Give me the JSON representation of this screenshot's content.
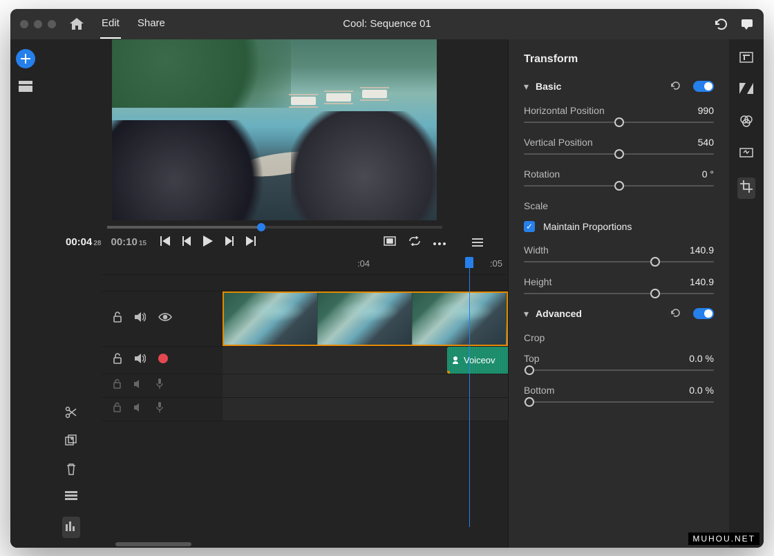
{
  "window": {
    "title": "Cool: Sequence 01"
  },
  "tabs": {
    "edit": "Edit",
    "share": "Share"
  },
  "timecode": {
    "current": "00:04",
    "current_frames": "28",
    "duration": "00:10",
    "duration_frames": "15"
  },
  "ruler": {
    "tick_a": ":04",
    "tick_b": ":05"
  },
  "audio_clip": {
    "label": "Voiceov"
  },
  "inspector": {
    "title": "Transform",
    "basic": {
      "title": "Basic",
      "h_pos": {
        "label": "Horizontal Position",
        "value": "990"
      },
      "v_pos": {
        "label": "Vertical Position",
        "value": "540"
      },
      "rotation": {
        "label": "Rotation",
        "value": "0 °"
      },
      "scale_label": "Scale",
      "maintain": "Maintain Proportions",
      "width": {
        "label": "Width",
        "value": "140.9"
      },
      "height": {
        "label": "Height",
        "value": "140.9"
      }
    },
    "advanced": {
      "title": "Advanced",
      "crop_label": "Crop",
      "top": {
        "label": "Top",
        "value": "0.0 %"
      },
      "bottom": {
        "label": "Bottom",
        "value": "0.0 %"
      }
    }
  },
  "watermark": "MUHOU.NET"
}
